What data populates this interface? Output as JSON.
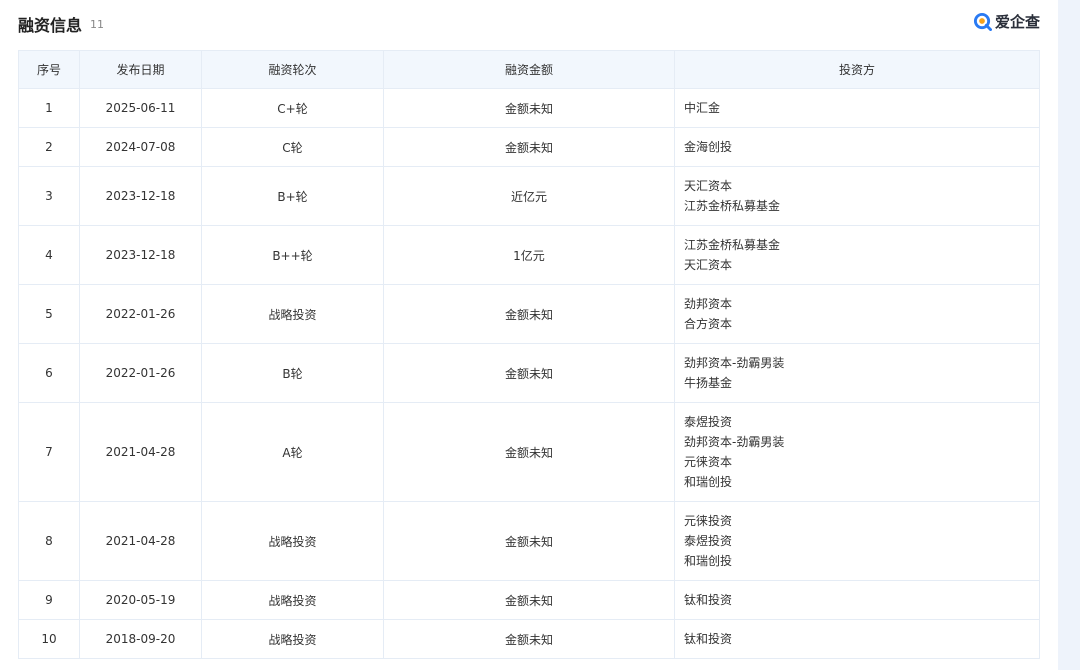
{
  "header": {
    "title": "融资信息",
    "count": "11",
    "brand": "爱企查"
  },
  "table": {
    "columns": [
      "序号",
      "发布日期",
      "融资轮次",
      "融资金额",
      "投资方"
    ],
    "rows": [
      {
        "no": "1",
        "date": "2025-06-11",
        "round": "C+轮",
        "amount": "金额未知",
        "investors": [
          "中汇金"
        ]
      },
      {
        "no": "2",
        "date": "2024-07-08",
        "round": "C轮",
        "amount": "金额未知",
        "investors": [
          "金海创投"
        ]
      },
      {
        "no": "3",
        "date": "2023-12-18",
        "round": "B+轮",
        "amount": "近亿元",
        "investors": [
          "天汇资本",
          "江苏金桥私募基金"
        ]
      },
      {
        "no": "4",
        "date": "2023-12-18",
        "round": "B++轮",
        "amount": "1亿元",
        "investors": [
          "江苏金桥私募基金",
          "天汇资本"
        ]
      },
      {
        "no": "5",
        "date": "2022-01-26",
        "round": "战略投资",
        "amount": "金额未知",
        "investors": [
          "劲邦资本",
          "合方资本"
        ]
      },
      {
        "no": "6",
        "date": "2022-01-26",
        "round": "B轮",
        "amount": "金额未知",
        "investors": [
          "劲邦资本-劲霸男装",
          "牛扬基金"
        ]
      },
      {
        "no": "7",
        "date": "2021-04-28",
        "round": "A轮",
        "amount": "金额未知",
        "investors": [
          "泰煜投资",
          "劲邦资本-劲霸男装",
          "元徕资本",
          "和瑞创投"
        ]
      },
      {
        "no": "8",
        "date": "2021-04-28",
        "round": "战略投资",
        "amount": "金额未知",
        "investors": [
          "元徕投资",
          "泰煜投资",
          "和瑞创投"
        ]
      },
      {
        "no": "9",
        "date": "2020-05-19",
        "round": "战略投资",
        "amount": "金额未知",
        "investors": [
          "钛和投资"
        ]
      },
      {
        "no": "10",
        "date": "2018-09-20",
        "round": "战略投资",
        "amount": "金额未知",
        "investors": [
          "钛和投资"
        ]
      }
    ]
  },
  "colors": {
    "header_bg": "#f2f7fd",
    "border": "#e5ecf5",
    "brand_blue": "#2a7af3",
    "brand_orange": "#f7a21b",
    "side_strip": "#eef3fb"
  },
  "icons": {
    "brand_logo": "aiqicha-logo-icon"
  }
}
